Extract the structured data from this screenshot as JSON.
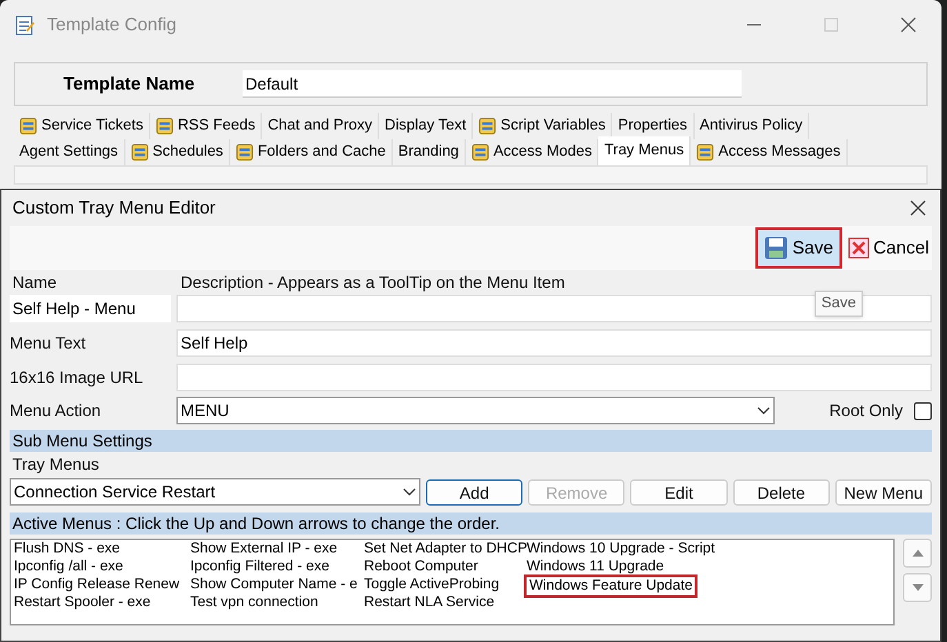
{
  "window": {
    "title": "Template Config"
  },
  "template_name": {
    "label": "Template Name",
    "value": "Default"
  },
  "tab_rows": [
    [
      {
        "label": "Service Tickets",
        "icon": true,
        "selected": false
      },
      {
        "label": "RSS Feeds",
        "icon": true,
        "selected": false
      },
      {
        "label": "Chat and Proxy",
        "icon": false,
        "selected": false
      },
      {
        "label": "Display Text",
        "icon": false,
        "selected": false
      },
      {
        "label": "Script Variables",
        "icon": true,
        "selected": false
      },
      {
        "label": "Properties",
        "icon": false,
        "selected": false
      },
      {
        "label": "Antivirus Policy",
        "icon": false,
        "selected": false
      }
    ],
    [
      {
        "label": "Agent Settings",
        "icon": false,
        "selected": false
      },
      {
        "label": "Schedules",
        "icon": true,
        "selected": false
      },
      {
        "label": "Folders and Cache",
        "icon": true,
        "selected": false
      },
      {
        "label": "Branding",
        "icon": false,
        "selected": false
      },
      {
        "label": "Access Modes",
        "icon": true,
        "selected": false
      },
      {
        "label": "Tray Menus",
        "icon": false,
        "selected": true
      },
      {
        "label": "Access Messages",
        "icon": true,
        "selected": false
      }
    ]
  ],
  "dialog": {
    "title": "Custom Tray Menu Editor",
    "save_button": {
      "label": "Save",
      "highlighted": true
    },
    "cancel_button": {
      "label": "Cancel"
    },
    "tooltip": "Save",
    "name_header": "Name",
    "description_header": "Description - Appears as a ToolTip on the Menu Item",
    "name_value": "Self Help - Menu",
    "menu_text": {
      "label": "Menu Text",
      "value": "Self Help"
    },
    "image_url": {
      "label": "16x16 Image URL"
    },
    "menu_action": {
      "label": "Menu Action",
      "value": "MENU"
    },
    "root_only": {
      "label": "Root Only",
      "checked": false
    },
    "sub_menu_header": "Sub Menu Settings",
    "tray_menus_label": "Tray Menus",
    "tray_menu_select": "Connection Service Restart",
    "buttons": [
      {
        "label": "Add",
        "disabled": false,
        "focused": true
      },
      {
        "label": "Remove",
        "disabled": true,
        "focused": false
      },
      {
        "label": "Edit",
        "disabled": false,
        "focused": false
      },
      {
        "label": "Delete",
        "disabled": false,
        "focused": false
      },
      {
        "label": "New Menu",
        "disabled": false,
        "focused": false
      }
    ],
    "active_menus_header": "Active Menus : Click the Up and Down arrows to change the order.",
    "active_menu_columns": [
      [
        {
          "label": "Flush DNS - exe",
          "highlighted": false
        },
        {
          "label": "Ipconfig /all - exe",
          "highlighted": false
        },
        {
          "label": "IP Config Release Renew",
          "highlighted": false
        },
        {
          "label": "Restart Spooler - exe",
          "highlighted": false
        }
      ],
      [
        {
          "label": "Show External IP - exe",
          "highlighted": false
        },
        {
          "label": "Ipconfig Filtered - exe",
          "highlighted": false
        },
        {
          "label": "Show Computer Name - e",
          "highlighted": false
        },
        {
          "label": "Test vpn connection",
          "highlighted": false
        }
      ],
      [
        {
          "label": "Set Net Adapter to DHCP",
          "highlighted": false
        },
        {
          "label": "Reboot Computer",
          "highlighted": false
        },
        {
          "label": "Toggle ActiveProbing",
          "highlighted": false
        },
        {
          "label": "Restart NLA Service",
          "highlighted": false
        }
      ],
      [
        {
          "label": "Windows 10 Upgrade - Script",
          "highlighted": false
        },
        {
          "label": "Windows 11 Upgrade",
          "highlighted": false
        },
        {
          "label": "Windows Feature Update",
          "highlighted": true
        }
      ]
    ]
  }
}
